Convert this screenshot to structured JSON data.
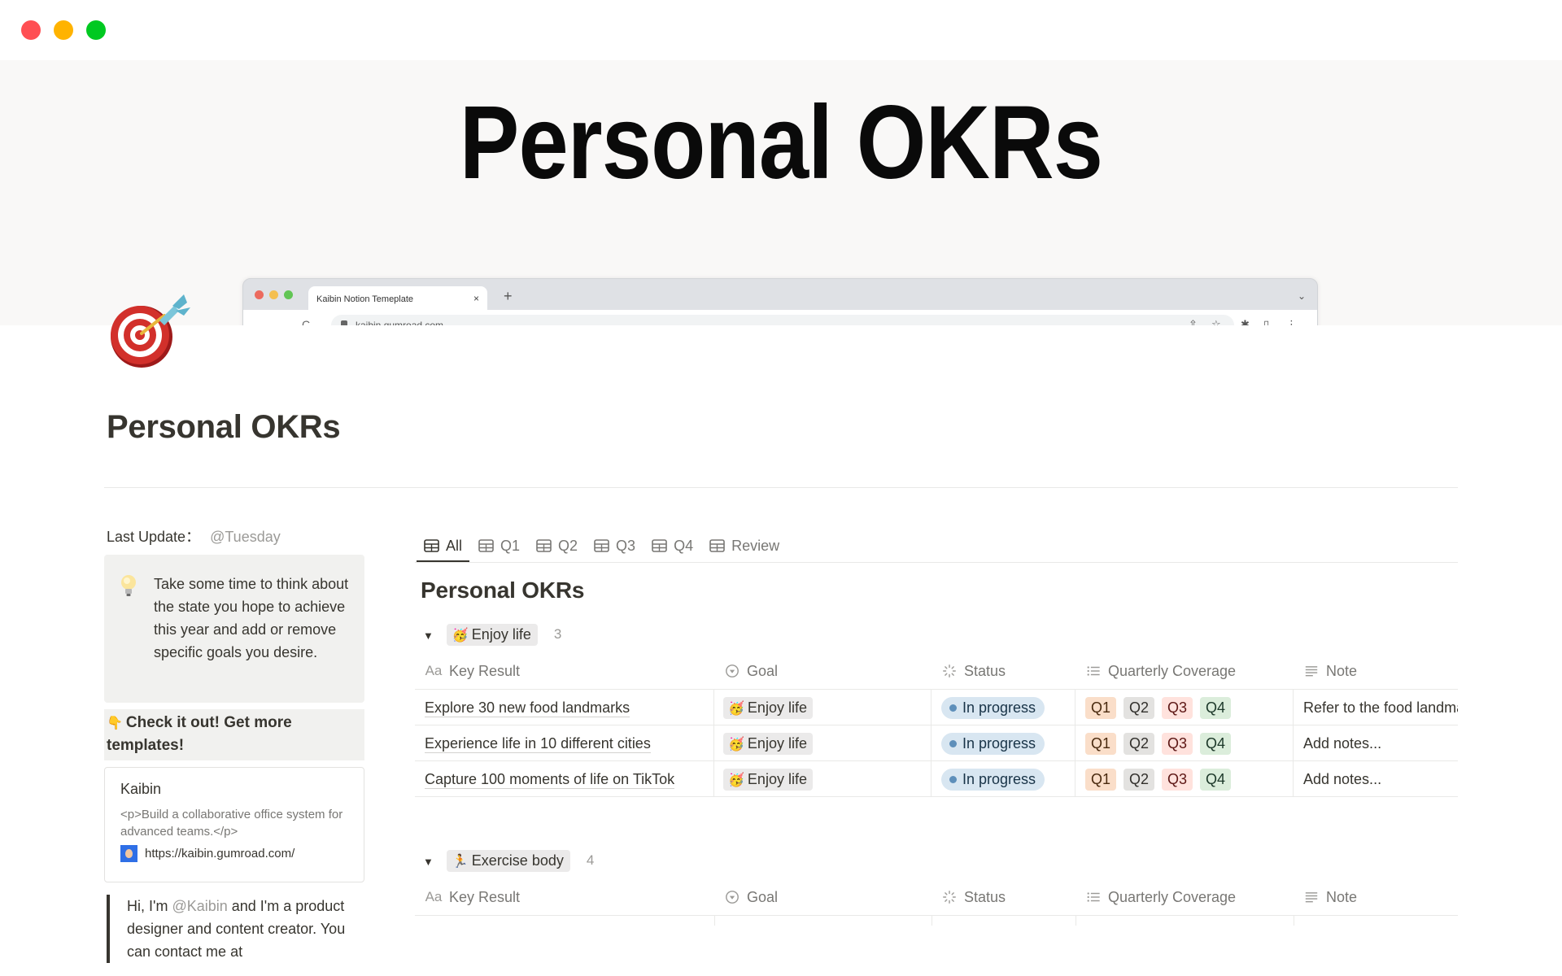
{
  "window": {
    "controls": [
      "close",
      "minimize",
      "maximize"
    ]
  },
  "cover": {
    "title": "Personal OKRs",
    "mock_browser": {
      "tab_title": "Kaibin Notion Temeplate",
      "tab_close": "×",
      "new_tab": "+",
      "menu_chevron": "⌄",
      "url": "kaibin.gumroad.com",
      "nav": {
        "back": "←",
        "forward": "→",
        "reload": "C"
      },
      "actions": {
        "share": "⇧",
        "star": "☆",
        "extensions": "✱",
        "sidebar": "▯",
        "more": "⋮"
      }
    }
  },
  "page": {
    "icon": "target-dart-icon",
    "title": "Personal OKRs"
  },
  "sidebar": {
    "last_update_label": "Last Update：",
    "last_update_value": "@Tuesday",
    "callout": {
      "icon": "lightbulb-icon",
      "text": "Take some time to think about the state you hope to achieve this year and add or remove specific goals you desire."
    },
    "cta": {
      "emoji": "👇",
      "text": "Check it out! Get more templates!"
    },
    "bookmark": {
      "title": "Kaibin",
      "description": "<p>Build a collaborative office system for advanced teams.</p>",
      "url": "https://kaibin.gumroad.com/"
    },
    "quote": {
      "prefix": "Hi, I'm ",
      "mention": "@Kaibin",
      "suffix": " and I'm a product designer and content creator. You can contact me at"
    }
  },
  "database": {
    "tabs": [
      {
        "label": "All",
        "active": true
      },
      {
        "label": "Q1",
        "active": false
      },
      {
        "label": "Q2",
        "active": false
      },
      {
        "label": "Q3",
        "active": false
      },
      {
        "label": "Q4",
        "active": false
      },
      {
        "label": "Review",
        "active": false
      }
    ],
    "title": "Personal OKRs",
    "columns": {
      "key_result": {
        "icon": "Aa",
        "label": "Key Result"
      },
      "goal": {
        "icon": "select-icon",
        "label": "Goal"
      },
      "status": {
        "icon": "status-icon",
        "label": "Status"
      },
      "quarterly": {
        "icon": "list-icon",
        "label": "Quarterly Coverage"
      },
      "note": {
        "icon": "text-lines-icon",
        "label": "Note"
      }
    },
    "groups": [
      {
        "emoji": "🥳",
        "name": "Enjoy life",
        "count": "3",
        "rows": [
          {
            "key_result": "Explore 30 new food landmarks",
            "goal_emoji": "🥳",
            "goal": "Enjoy life",
            "status": "In progress",
            "quarters": [
              "Q1",
              "Q2",
              "Q3",
              "Q4"
            ],
            "note": "Refer to the food landmarks"
          },
          {
            "key_result": "Experience life in 10 different cities",
            "goal_emoji": "🥳",
            "goal": "Enjoy life",
            "status": "In progress",
            "quarters": [
              "Q1",
              "Q2",
              "Q3",
              "Q4"
            ],
            "note": "Add notes..."
          },
          {
            "key_result": "Capture 100 moments of life on TikTok",
            "goal_emoji": "🥳",
            "goal": "Enjoy life",
            "status": "In progress",
            "quarters": [
              "Q1",
              "Q2",
              "Q3",
              "Q4"
            ],
            "note": "Add notes..."
          }
        ]
      },
      {
        "emoji": "🏃",
        "name": "Exercise body",
        "count": "4",
        "rows": []
      }
    ],
    "quarter_colors": {
      "Q1": {
        "bg": "#fadec9",
        "fg": "#49290e"
      },
      "Q2": {
        "bg": "#e3e2e0",
        "fg": "#32302c"
      },
      "Q3": {
        "bg": "#ffe2dd",
        "fg": "#5d1715"
      },
      "Q4": {
        "bg": "#dbeddb",
        "fg": "#1c3829"
      }
    },
    "status_colors": {
      "in_progress_bg": "#d8e6f1",
      "in_progress_dot": "#5e8fba"
    }
  }
}
